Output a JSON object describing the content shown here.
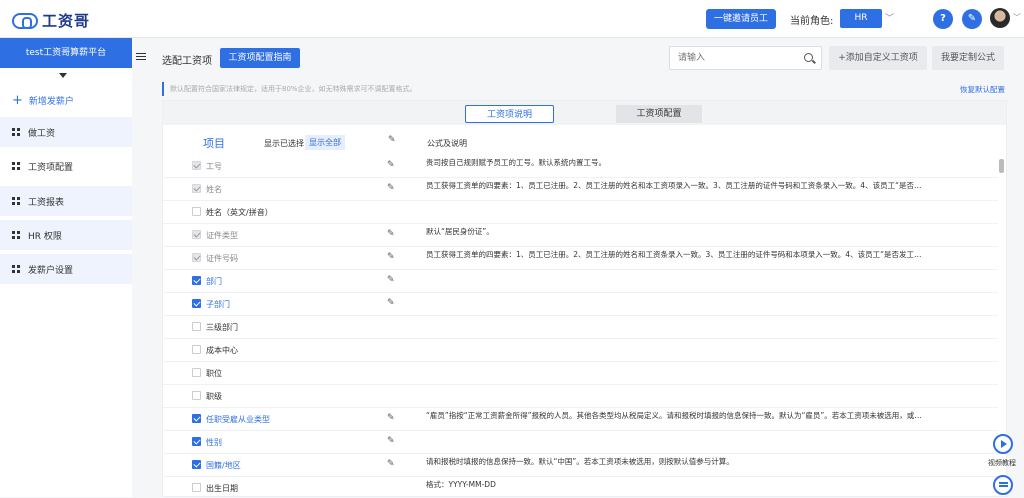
{
  "brand": {
    "name": "工资哥"
  },
  "header": {
    "invite_label": "一键邀请员工",
    "role_label": "当前角色:",
    "role_value": "HR",
    "help_label": "?"
  },
  "sidebar": {
    "company": "test工资哥算薪平台",
    "add_label": "新增发薪户",
    "items": [
      {
        "label": "做工资"
      },
      {
        "label": "工资项配置"
      },
      {
        "label": "工资报表"
      },
      {
        "label": "HR 权限"
      },
      {
        "label": "发薪户设置"
      }
    ]
  },
  "toolbar": {
    "title": "选配工资项",
    "guide_label": "工资项配置指南",
    "search_placeholder": "请输入",
    "add_custom_label": "+添加自定义工资项",
    "custom_formula_label": "我要定制公式"
  },
  "notice": {
    "text": "默认配置符合国家法律规定，适用于80%企业，如无特殊需求可不调配置格式。",
    "restore_label": "恢复默认配置"
  },
  "tabs": [
    {
      "label": "工资项说明"
    },
    {
      "label": "工资项配置"
    }
  ],
  "table": {
    "col_item": "项目",
    "show_selected": "显示已选择",
    "show_all": "显示全部",
    "col_formula": "公式及说明",
    "rows": [
      {
        "name": "工号",
        "desc": "贵司按自己规则赋予员工的工号。默认系统内置工号。"
      },
      {
        "name": "姓名",
        "desc": "员工获得工资单的四要素：1、员工已注册。2、员工注册的姓名和本工资项录入一致。3、员工注册的证件号码和工资条录入一致。4、该员工“是否发…"
      },
      {
        "name": "姓名（英文/拼音）",
        "desc": ""
      },
      {
        "name": "证件类型",
        "desc": "默认“居民身份证”。"
      },
      {
        "name": "证件号码",
        "desc": "员工获得工资单的四要素：1、员工已注册。2、员工注册的姓名和工资条录入一致。3、员工注册的证件号码和本项录入一致。4、该员工“是否发工资…"
      },
      {
        "name": "部门",
        "desc": ""
      },
      {
        "name": "子部门",
        "desc": ""
      },
      {
        "name": "三级部门",
        "desc": ""
      },
      {
        "name": "成本中心",
        "desc": ""
      },
      {
        "name": "职位",
        "desc": ""
      },
      {
        "name": "职级",
        "desc": ""
      },
      {
        "name": "任职受雇从业类型",
        "desc": "“雇员”指按“正常工资薪金所得”报税的人员。其他各类型均从税局定义。请和报税时填报的信息保持一致。默认为“雇员”。若本工资项未被选用，或未…"
      },
      {
        "name": "性别",
        "desc": ""
      },
      {
        "name": "国籍/地区",
        "desc": "请和报税时填报的信息保持一致。默认“中国”。若本工资项未被选用，则按默认值参与计算。"
      },
      {
        "name": "出生日期",
        "desc": "格式：YYYY-MM-DD"
      }
    ]
  },
  "help": {
    "video_label": "视频教程"
  }
}
